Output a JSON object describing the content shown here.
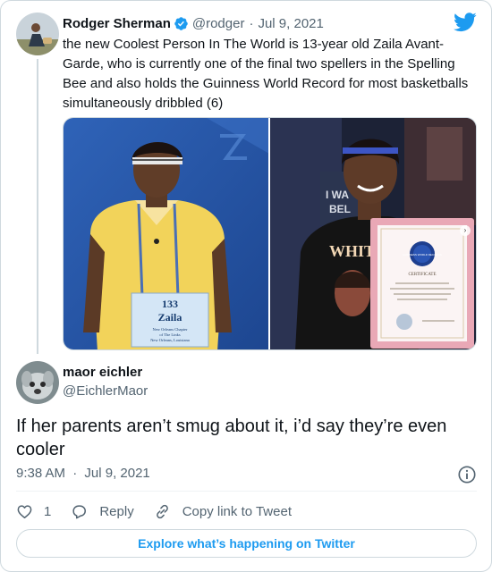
{
  "parent_tweet": {
    "author_name": "Rodger Sherman",
    "handle": "@rodger",
    "separator": "·",
    "date": "Jul 9, 2021",
    "text": "the new Coolest Person In The World is 13-year old Zaila Avant-Garde, who is currently one of the final two spellers in the Spelling Bee and also holds the Guinness World Record for most basketballs simultaneously dribbled (6)",
    "media": [
      {
        "icon": "photo-icon",
        "bib_number": "133",
        "bib_name": "Zaila",
        "bib_line1": "New Orleans Chapter",
        "bib_line2": "of The Links",
        "bib_line3": "New Orleans, Louisiana"
      },
      {
        "icon": "photo-icon",
        "sign_text_1": "I WA",
        "sign_text_2": "BEL",
        "shirt_text": "WHIT",
        "certificate_label": "CERTIFICATE",
        "seal_text": "GUINNESS WORLD RECORDS"
      }
    ]
  },
  "reply_tweet": {
    "author_name": "maor eichler",
    "handle": "@EichlerMaor",
    "text": "If her parents aren’t smug about it, i’d say they’re even cooler",
    "time": "9:38 AM",
    "separator": "·",
    "date": "Jul 9, 2021"
  },
  "actions": {
    "like_count": "1",
    "reply_label": "Reply",
    "copy_link_label": "Copy link to Tweet"
  },
  "explore_label": "Explore what’s happening on Twitter",
  "icons": {
    "verified": "verified-badge-icon",
    "logo": "twitter-bird-icon",
    "info": "info-icon",
    "like": "heart-icon",
    "reply": "speech-bubble-icon",
    "copy_link": "link-icon"
  },
  "colors": {
    "brand": "#1d9bf0",
    "text": "#0f1419",
    "muted": "#536471",
    "border": "#cfd9de"
  }
}
